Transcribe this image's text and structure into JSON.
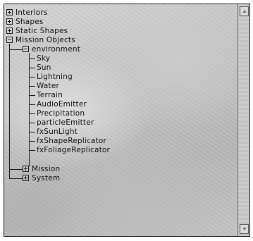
{
  "tree": {
    "categories": [
      {
        "label": "Interiors",
        "expanded": false
      },
      {
        "label": "Shapes",
        "expanded": false
      },
      {
        "label": "Static Shapes",
        "expanded": false
      },
      {
        "label": "Mission Objects",
        "expanded": true
      }
    ],
    "mission_objects": {
      "environment": {
        "label": "environment",
        "expanded": true,
        "items": [
          "Sky",
          "Sun",
          "Lightning",
          "Water",
          "Terrain",
          "AudioEmitter",
          "Precipitation",
          "particleEmitter",
          "fxSunLight",
          "fxShapeReplicator",
          "fxFoliageReplicator"
        ]
      },
      "groups": [
        {
          "label": "Mission",
          "expanded": false
        },
        {
          "label": "System",
          "expanded": false
        }
      ]
    }
  },
  "scrollbar": {
    "up_icon": "arrow-up-icon",
    "down_icon": "arrow-down-icon"
  }
}
